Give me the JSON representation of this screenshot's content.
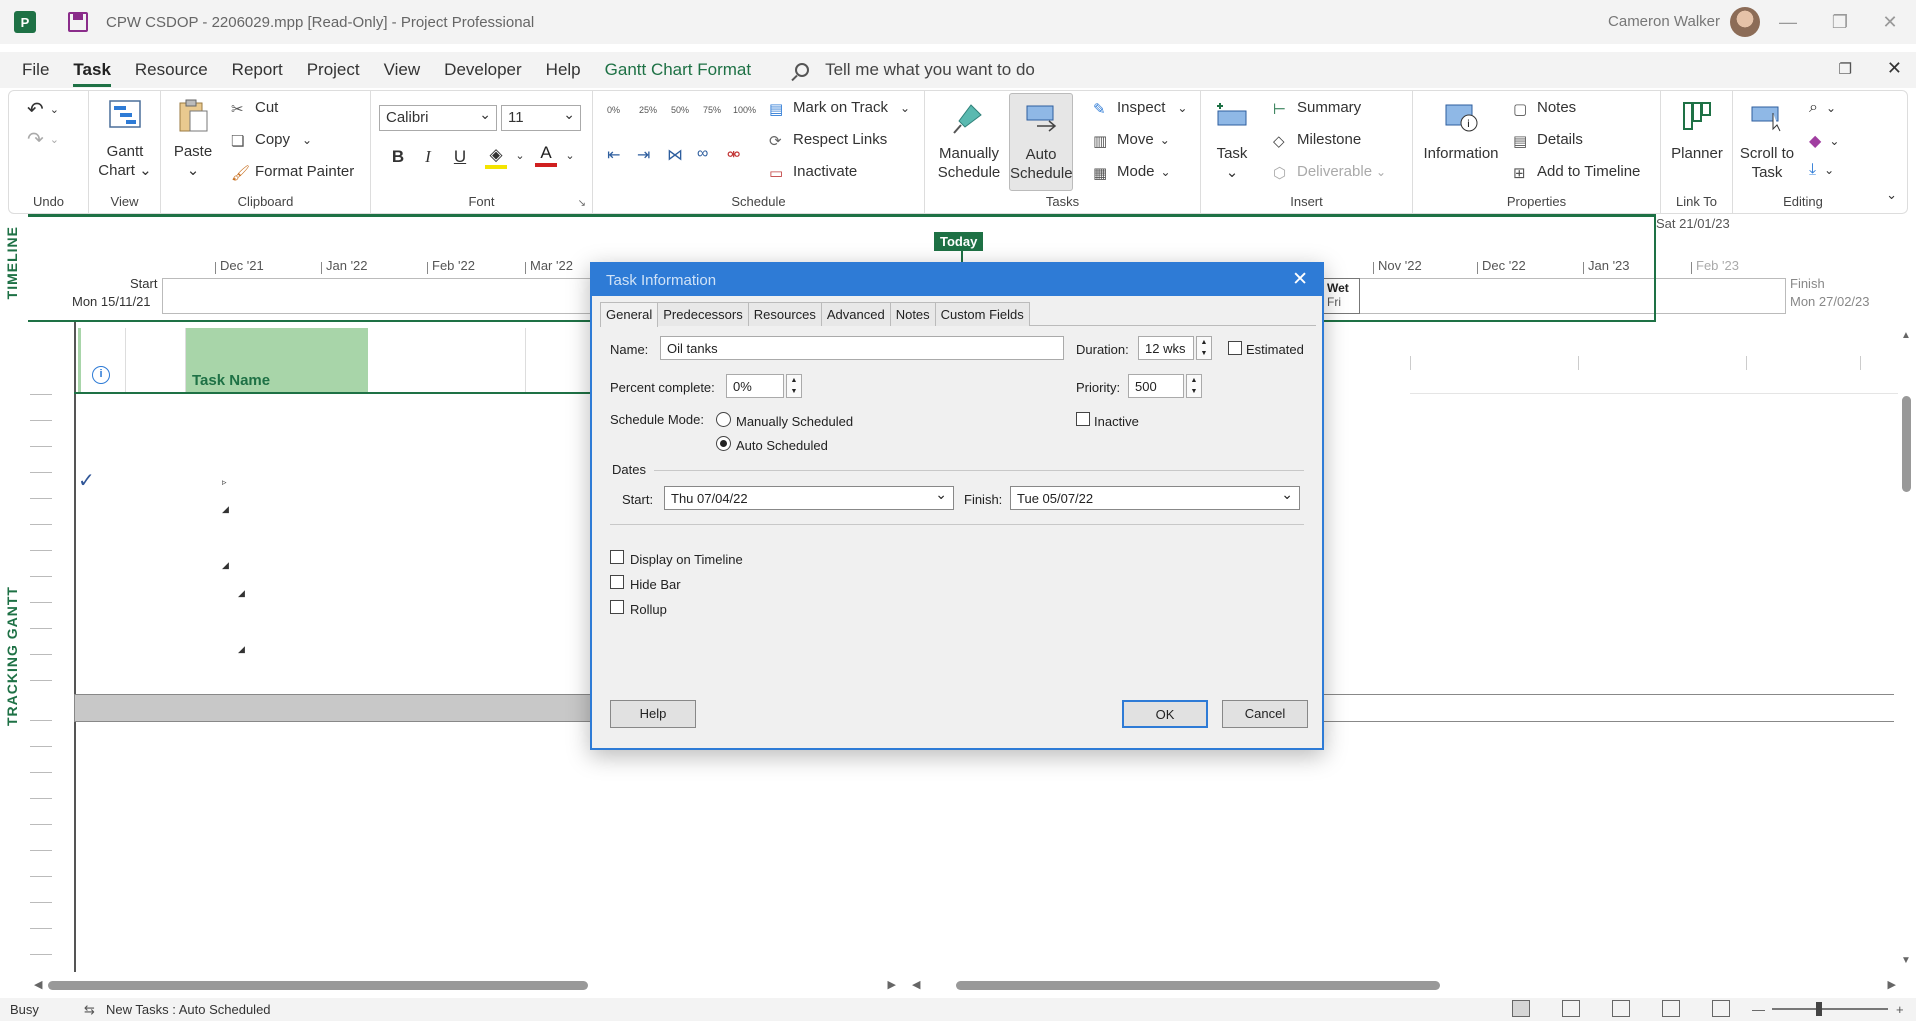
{
  "window": {
    "title": "CPW CSDOP - 2206029.mpp [Read-Only]  -  Project Professional",
    "user": "Cameron Walker"
  },
  "menu": {
    "tabs": [
      "File",
      "Task",
      "Resource",
      "Report",
      "Project",
      "View",
      "Developer",
      "Help",
      "Gantt Chart Format"
    ],
    "tellme": "Tell me what you want to do"
  },
  "ribbon": {
    "groups": {
      "undo": "Undo",
      "view": "View",
      "clipboard": "Clipboard",
      "font": "Font",
      "schedule": "Schedule",
      "tasks": "Tasks",
      "insert": "Insert",
      "properties": "Properties",
      "linkto": "Link To",
      "editing": "Editing"
    },
    "gantt_chart": "Gantt Chart",
    "paste": "Paste",
    "cut": "Cut",
    "copy": "Copy",
    "format_painter": "Format Painter",
    "font_name": "Calibri",
    "font_size": "11",
    "bold": "B",
    "italic": "I",
    "underline": "U",
    "pct": [
      "0%",
      "25%",
      "50%",
      "75%",
      "100%"
    ],
    "mark_on_track": "Mark on Track",
    "respect_links": "Respect Links",
    "inactivate": "Inactivate",
    "manually_schedule": "Manually Schedule",
    "auto_schedule": "Auto Schedule",
    "inspect": "Inspect",
    "move": "Move",
    "mode": "Mode",
    "task": "Task",
    "summary": "Summary",
    "milestone": "Milestone",
    "deliverable": "Deliverable",
    "information": "Information",
    "notes": "Notes",
    "details": "Details",
    "add_to_timeline": "Add to Timeline",
    "planner": "Planner",
    "scroll_to_task": "Scroll to Task"
  },
  "timeline": {
    "label": "TIMELINE",
    "start_label": "Start",
    "start_date": "Mon 15/11/21",
    "finish_label": "Finish",
    "finish_date": "Mon 27/02/23",
    "top_date": "Sat 21/01/23",
    "today": "Today",
    "months_left": [
      "Dec '21",
      "Jan '22",
      "Feb '22",
      "Mar '22"
    ],
    "months_right": [
      "Nov '22",
      "Dec '22",
      "Jan '23",
      "Feb '23"
    ],
    "bar_label_1": "Wet",
    "bar_label_2": "Fri"
  },
  "gantt": {
    "label": "TRACKING GANTT",
    "task_name_header": "Task Name"
  },
  "status": {
    "mode": "Busy",
    "new_tasks": "New Tasks : Auto Scheduled"
  },
  "dialog": {
    "title": "Task Information",
    "tabs": [
      "General",
      "Predecessors",
      "Resources",
      "Advanced",
      "Notes",
      "Custom Fields"
    ],
    "name_label": "Name:",
    "name_value": "Oil tanks",
    "duration_label": "Duration:",
    "duration_value": "12 wks",
    "estimated_label": "Estimated",
    "percent_label": "Percent complete:",
    "percent_value": "0%",
    "priority_label": "Priority:",
    "priority_value": "500",
    "schedule_mode_label": "Schedule Mode:",
    "manually_scheduled": "Manually Scheduled",
    "auto_scheduled": "Auto Scheduled",
    "inactive_label": "Inactive",
    "dates_label": "Dates",
    "start_label": "Start:",
    "start_value": "Thu 07/04/22",
    "finish_label": "Finish:",
    "finish_value": "Tue 05/07/22",
    "display_on_timeline": "Display on Timeline",
    "hide_bar": "Hide Bar",
    "rollup": "Rollup",
    "help": "Help",
    "ok": "OK",
    "cancel": "Cancel"
  }
}
